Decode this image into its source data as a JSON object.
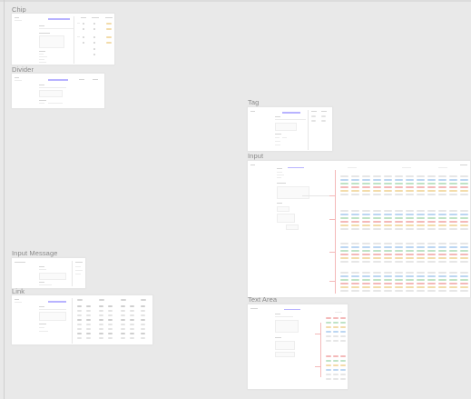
{
  "canvas": {
    "background": "#e9e9e9"
  },
  "frames": {
    "chip": {
      "label": "Chip"
    },
    "divider": {
      "label": "Divider"
    },
    "tag": {
      "label": "Tag"
    },
    "input": {
      "label": "Input"
    },
    "input_message": {
      "label": "Input Message"
    },
    "link": {
      "label": "Link"
    },
    "text_area": {
      "label": "Text Area"
    }
  },
  "colors": {
    "accent": "#b8b3ff",
    "error": "#f4b9b9",
    "success": "#bfe3c6",
    "warning": "#f3dcaa",
    "info": "#bcd6f2"
  }
}
